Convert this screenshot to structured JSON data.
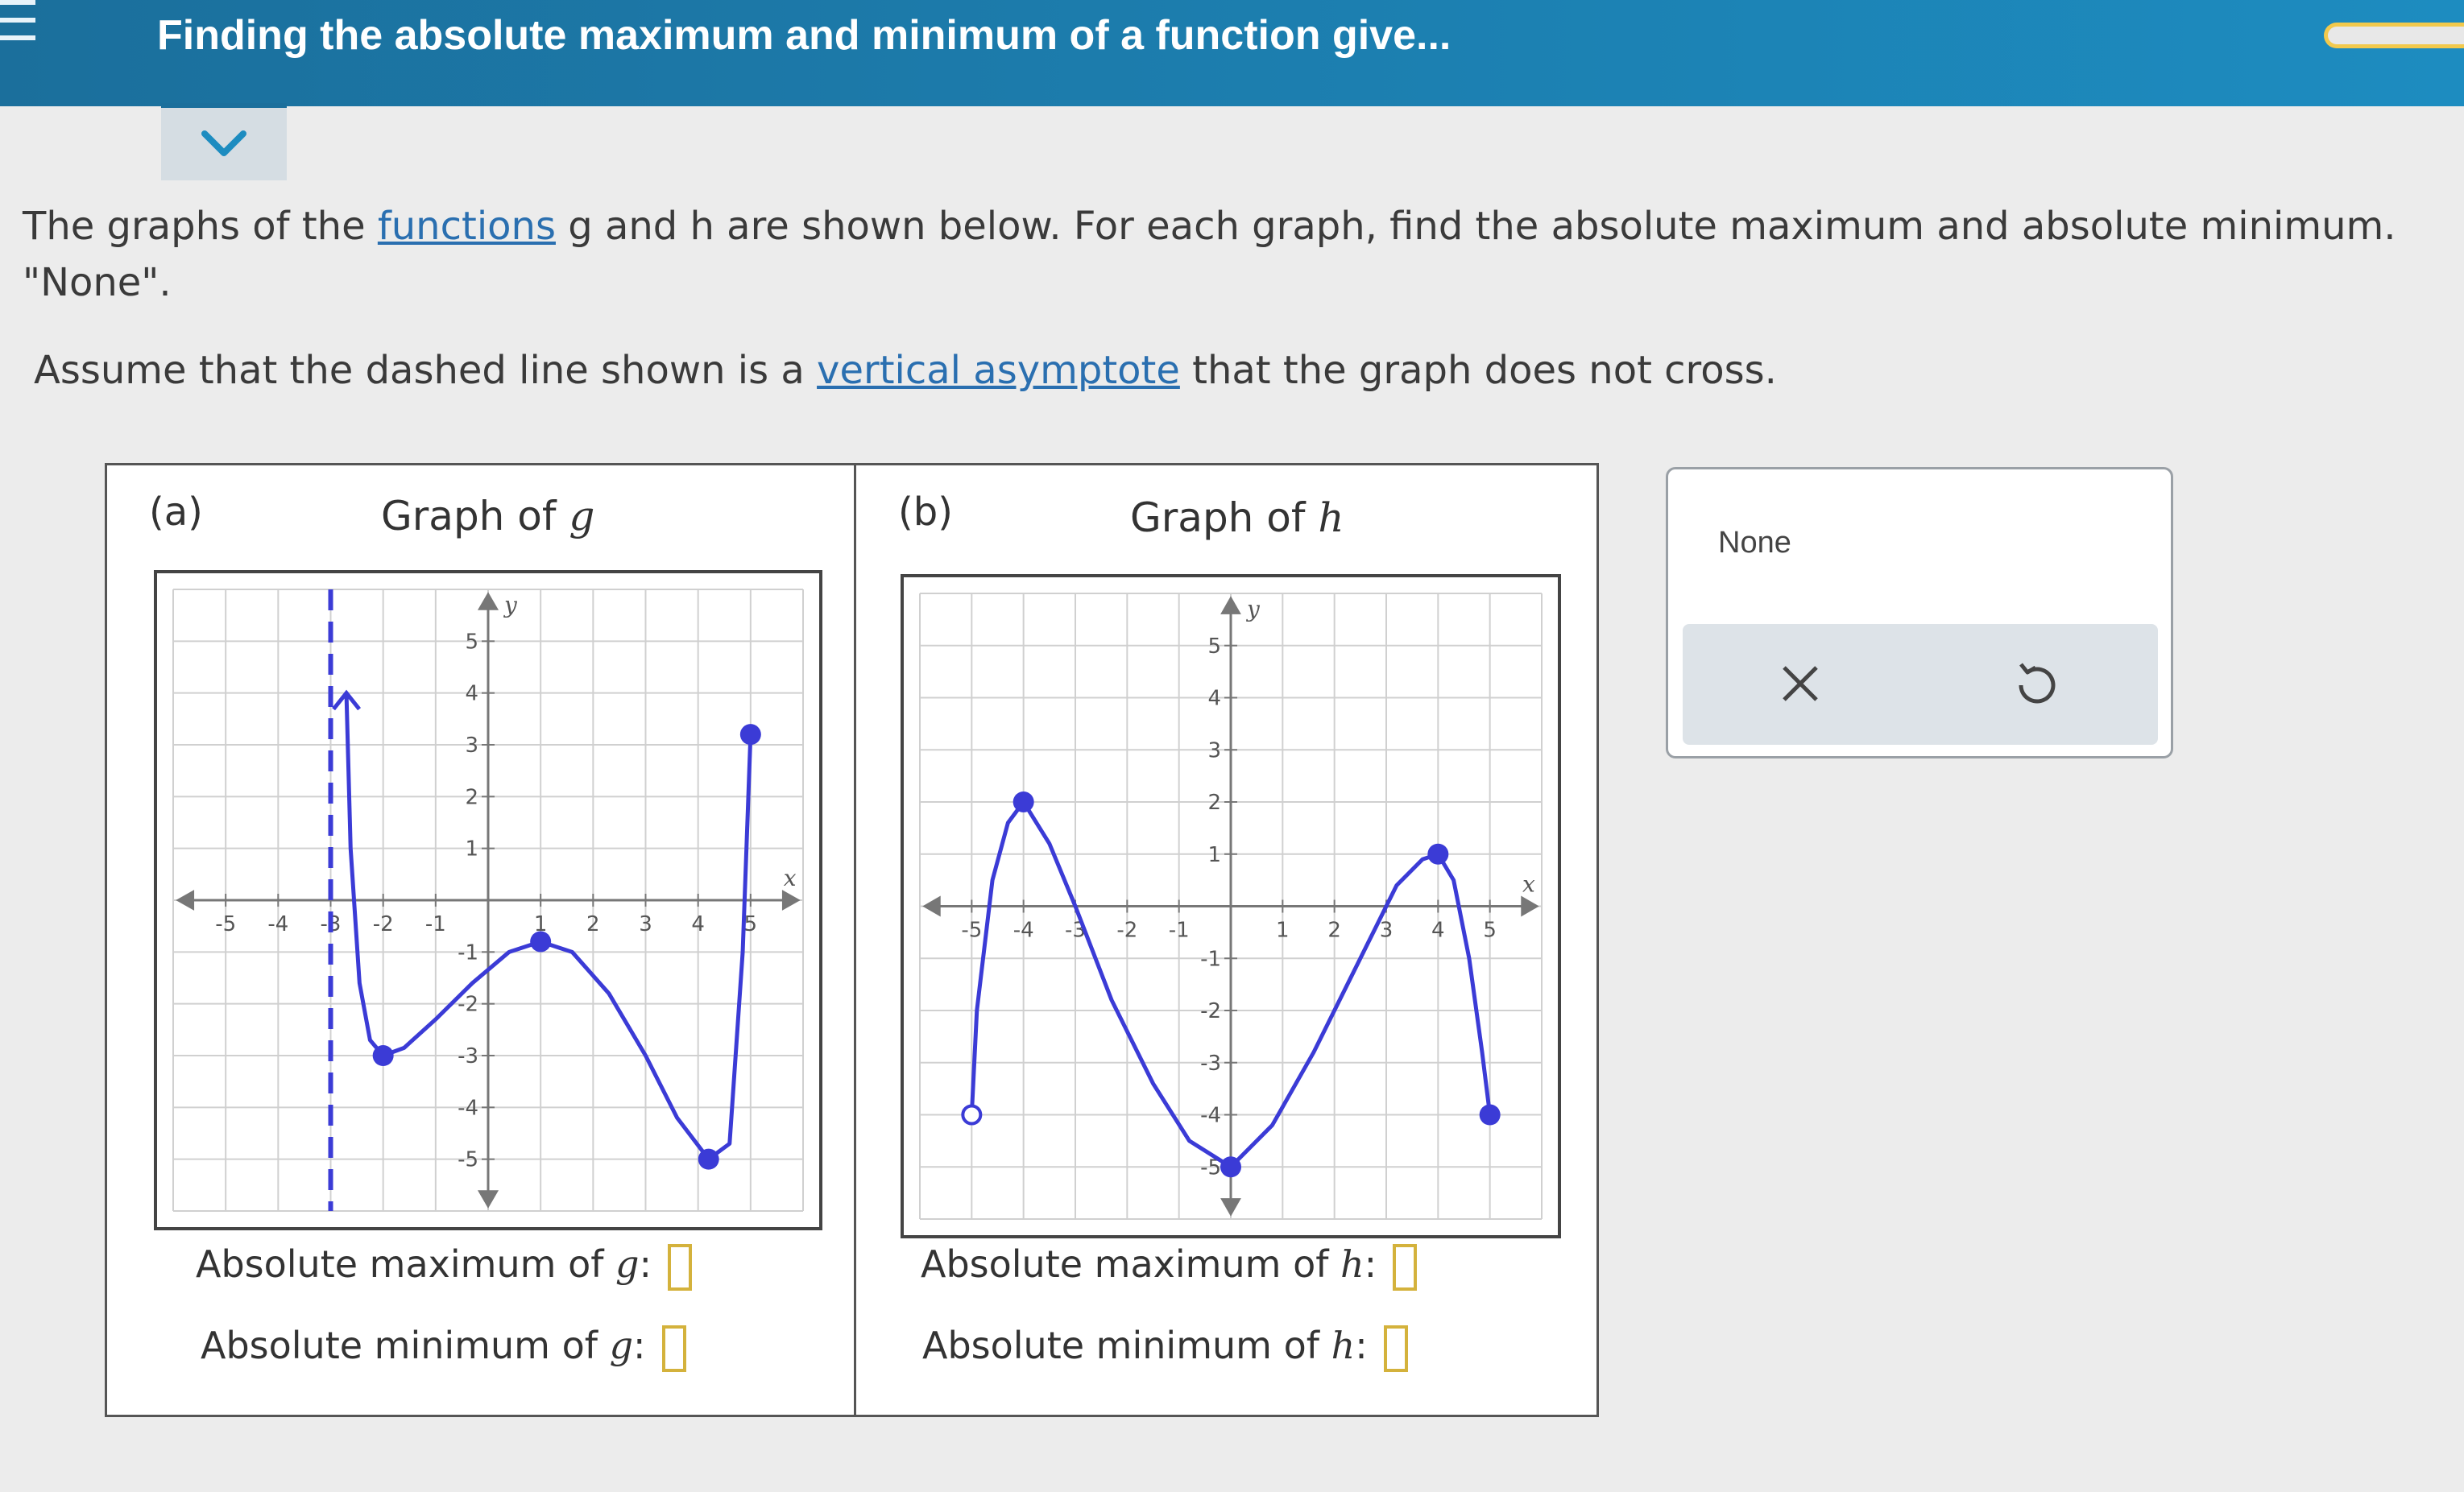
{
  "header": {
    "title": "Finding the absolute maximum and minimum of a function give..."
  },
  "prompt": {
    "line1_a": "The graphs of the ",
    "line1_link": "functions",
    "line1_b": " g and h are shown below. For each graph, find the absolute maximum and absolute minimum.",
    "line2": "\"None\".",
    "line3_a": "Assume that the dashed line shown is a ",
    "line3_link": "vertical asymptote",
    "line3_b": " that the graph does not cross."
  },
  "panels": [
    {
      "label": "(a)",
      "title_text": "Graph of ",
      "fn": "g",
      "max_label": "Absolute maximum of ",
      "min_label": "Absolute minimum of ",
      "graph": {
        "x_ticks": [
          "-5",
          "-4",
          "-3",
          "-2",
          "-1",
          "1",
          "2",
          "3",
          "4",
          "5"
        ],
        "y_ticks": [
          "5",
          "4",
          "3",
          "2",
          "1",
          "-1",
          "-2",
          "-3",
          "-4",
          "-5"
        ],
        "x_axis_label": "x",
        "y_axis_label": "y",
        "asymptote_x": -3,
        "closed_points": [
          [
            -2,
            -3
          ],
          [
            1,
            -0.8
          ],
          [
            4.2,
            -5
          ],
          [
            5,
            3.2
          ]
        ],
        "curve_points": [
          [
            -2.7,
            4
          ],
          [
            -2.62,
            1
          ],
          [
            -2.45,
            -1.6
          ],
          [
            -2.25,
            -2.7
          ],
          [
            -2,
            -3
          ],
          [
            -1.6,
            -2.85
          ],
          [
            -1,
            -2.3
          ],
          [
            -0.3,
            -1.6
          ],
          [
            0.4,
            -1
          ],
          [
            1,
            -0.8
          ],
          [
            1.6,
            -1
          ],
          [
            2.3,
            -1.8
          ],
          [
            3,
            -3
          ],
          [
            3.6,
            -4.2
          ],
          [
            4.2,
            -5
          ],
          [
            4.6,
            -4.7
          ],
          [
            4.85,
            -1
          ],
          [
            5,
            3.2
          ]
        ]
      },
      "colors": {
        "curve": "#3b3bd6",
        "asymptote": "#3b3bd6"
      }
    },
    {
      "label": "(b)",
      "title_text": "Graph of ",
      "fn": "h",
      "max_label": "Absolute maximum of ",
      "min_label": "Absolute minimum of ",
      "graph": {
        "x_ticks": [
          "-5",
          "-4",
          "-3",
          "-2",
          "-1",
          "1",
          "2",
          "3",
          "4",
          "5"
        ],
        "y_ticks": [
          "5",
          "4",
          "3",
          "2",
          "1",
          "-1",
          "-2",
          "-3",
          "-4",
          "-5"
        ],
        "x_axis_label": "x",
        "y_axis_label": "y",
        "open_points": [
          [
            -5,
            -4
          ]
        ],
        "closed_points": [
          [
            -4,
            2
          ],
          [
            0,
            -5
          ],
          [
            4,
            1
          ],
          [
            5,
            -4
          ]
        ],
        "curve_points": [
          [
            -5,
            -4
          ],
          [
            -4.9,
            -2
          ],
          [
            -4.6,
            0.5
          ],
          [
            -4.3,
            1.6
          ],
          [
            -4,
            2
          ],
          [
            -3.5,
            1.2
          ],
          [
            -3,
            0
          ],
          [
            -2.3,
            -1.8
          ],
          [
            -1.5,
            -3.4
          ],
          [
            -0.8,
            -4.5
          ],
          [
            0,
            -5
          ],
          [
            0.8,
            -4.2
          ],
          [
            1.6,
            -2.8
          ],
          [
            2.5,
            -1
          ],
          [
            3.2,
            0.4
          ],
          [
            3.7,
            0.9
          ],
          [
            4,
            1
          ],
          [
            4.3,
            0.5
          ],
          [
            4.6,
            -1
          ],
          [
            4.85,
            -2.8
          ],
          [
            5,
            -4
          ]
        ]
      },
      "colors": {
        "curve": "#3b3bd6"
      }
    }
  ],
  "side_panel": {
    "none_label": "None",
    "clear_icon": "close-icon",
    "undo_icon": "undo-icon"
  },
  "colors": {
    "header_bg": "#1d8cc0",
    "curve": "#3b3bd6",
    "answer_box_border": "#d4b23c",
    "link": "#2a6fb0"
  }
}
